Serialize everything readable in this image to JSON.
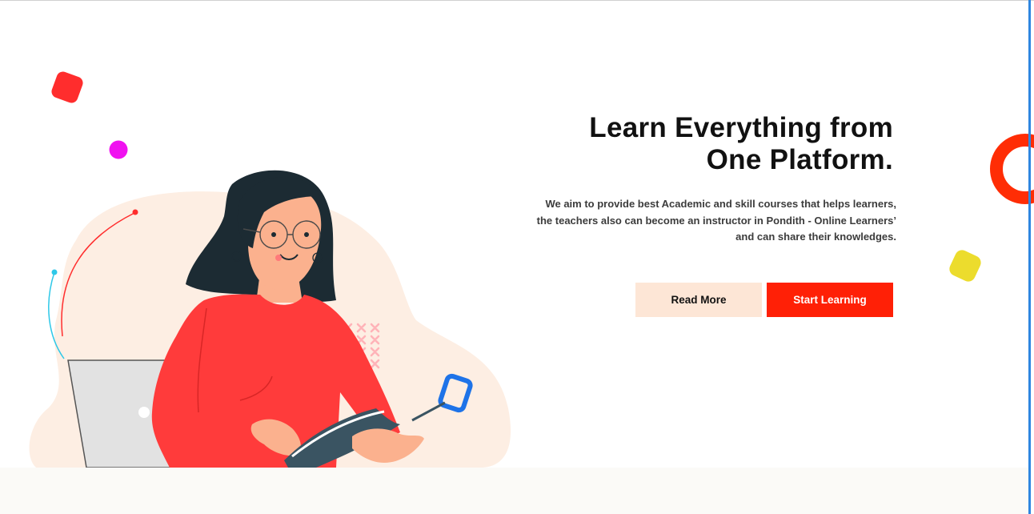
{
  "hero": {
    "headline_line1": "Learn Everything from",
    "headline_line2": "One Platform.",
    "description_line1": "We aim to provide best Academic and skill courses that helps learners,",
    "description_line2": "the teachers also can become an instructor in Pondith - Online Learners’",
    "description_line3": "and can share their knowledges."
  },
  "buttons": {
    "read_more": "Read More",
    "start_learning": "Start Learning"
  },
  "colors": {
    "accent_red": "#ff2006",
    "soft_peach": "#fde6d6",
    "shirt_red": "#ff3b3b",
    "highlight_blue": "#1e73e8",
    "decor_yellow": "#ecdc2d",
    "decor_magenta": "#f012f0",
    "decor_cyan": "#2ec8e8"
  },
  "illustration": {
    "subject": "woman-reading-book-with-laptop"
  }
}
